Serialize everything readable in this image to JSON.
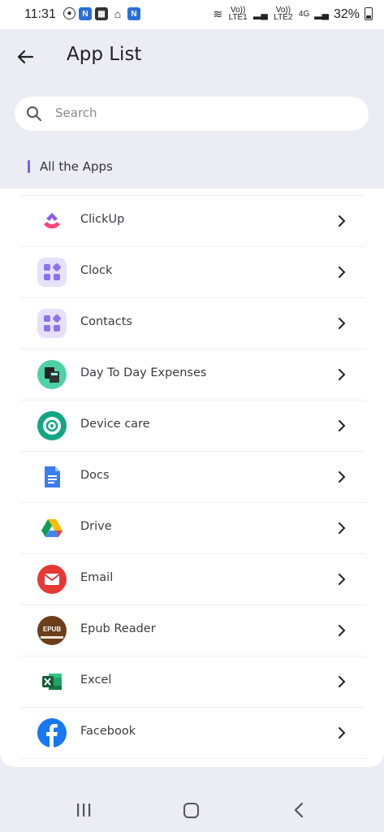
{
  "status_bar": {
    "time": "11:31",
    "network_1": "Vo)) LTE1",
    "network_2": "Vo)) LTE2",
    "network_type": "4G",
    "battery": "32%"
  },
  "header": {
    "title": "App List",
    "back_icon": "arrow-left-icon"
  },
  "search": {
    "placeholder": "Search",
    "icon": "search-icon"
  },
  "section": {
    "title": "All the Apps",
    "accent": "#7b5cf5"
  },
  "apps": [
    {
      "label": "ClickUp",
      "icon": "clickup-icon"
    },
    {
      "label": "Clock",
      "icon": "clock-icon"
    },
    {
      "label": "Contacts",
      "icon": "contacts-icon"
    },
    {
      "label": "Day To Day Expenses",
      "icon": "expenses-icon"
    },
    {
      "label": "Device care",
      "icon": "device-care-icon"
    },
    {
      "label": "Docs",
      "icon": "docs-icon"
    },
    {
      "label": "Drive",
      "icon": "drive-icon"
    },
    {
      "label": "Email",
      "icon": "email-icon"
    },
    {
      "label": "Epub Reader",
      "icon": "epub-icon",
      "icon_text": "EPUB"
    },
    {
      "label": "Excel",
      "icon": "excel-icon"
    },
    {
      "label": "Facebook",
      "icon": "facebook-icon"
    }
  ],
  "nav": {
    "recents": "recents-icon",
    "home": "home-icon",
    "back": "back-icon"
  }
}
